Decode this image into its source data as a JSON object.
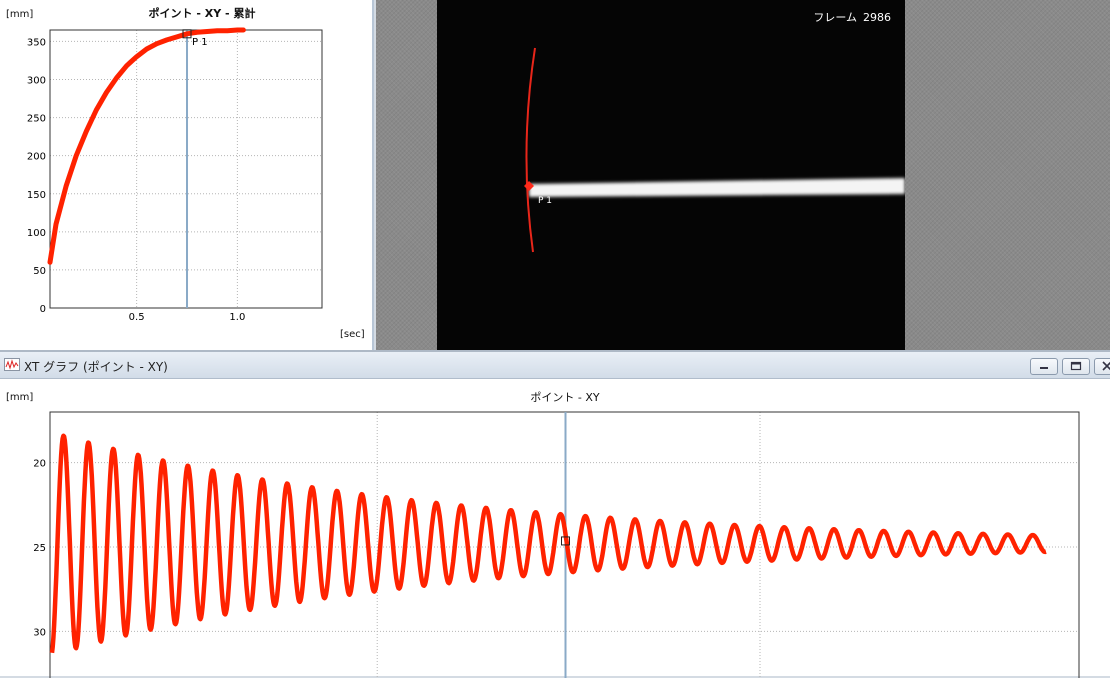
{
  "top_chart": {
    "title": "ポイント - XY - 累計",
    "y_unit": "[mm]",
    "x_unit": "[sec]",
    "marker_label": "P 1",
    "y_ticks": [
      "350",
      "300",
      "250",
      "200",
      "150",
      "100",
      "50",
      "0"
    ],
    "x_ticks": [
      "0.5",
      "1.0"
    ]
  },
  "video": {
    "frame_label": "フレーム",
    "frame_number": "2986",
    "point_label": "P 1"
  },
  "xt_window": {
    "title": "XT グラフ (ポイント - XY)",
    "chart_title": "ポイント - XY",
    "y_unit": "[mm]",
    "y_ticks": [
      "30",
      "25",
      "20"
    ]
  },
  "colors": {
    "trace": "#ff2200",
    "cursor": "#8aaac7",
    "grid": "#b5b5b5"
  },
  "icons": [
    "xt-graph-icon",
    "minimize-icon",
    "maximize-icon",
    "close-icon"
  ],
  "chart_data": [
    {
      "type": "line",
      "title": "ポイント - XY - 累計",
      "ylabel": "[mm]",
      "xlabel": "[sec]",
      "xlim": [
        0.07,
        1.42
      ],
      "ylim": [
        0,
        365
      ],
      "x_ticks": [
        0.5,
        1.0
      ],
      "y_ticks": [
        0,
        50,
        100,
        150,
        200,
        250,
        300,
        350
      ],
      "cursor_x": 0.75,
      "grid": true,
      "series": [
        {
          "x": [
            0.07,
            0.1,
            0.15,
            0.2,
            0.25,
            0.3,
            0.35,
            0.4,
            0.45,
            0.5,
            0.55,
            0.6,
            0.65,
            0.7,
            0.75,
            0.8,
            0.85,
            0.9,
            0.95,
            1.0,
            1.03
          ],
          "y": [
            60,
            110,
            160,
            200,
            232,
            260,
            283,
            302,
            318,
            330,
            340,
            347,
            352,
            356,
            360,
            362,
            363,
            364,
            364,
            365,
            365
          ]
        }
      ]
    },
    {
      "type": "line",
      "title": "ポイント - XY",
      "ylabel": "[mm]",
      "ylim": [
        17,
        33
      ],
      "y_ticks": [
        20,
        25,
        30
      ],
      "grid": true,
      "cursor_fraction": 0.5,
      "oscillation": {
        "baseline": 25.2,
        "initial_amplitude": 6.6,
        "cycles": 40,
        "decay_rate": 2.6
      }
    }
  ]
}
